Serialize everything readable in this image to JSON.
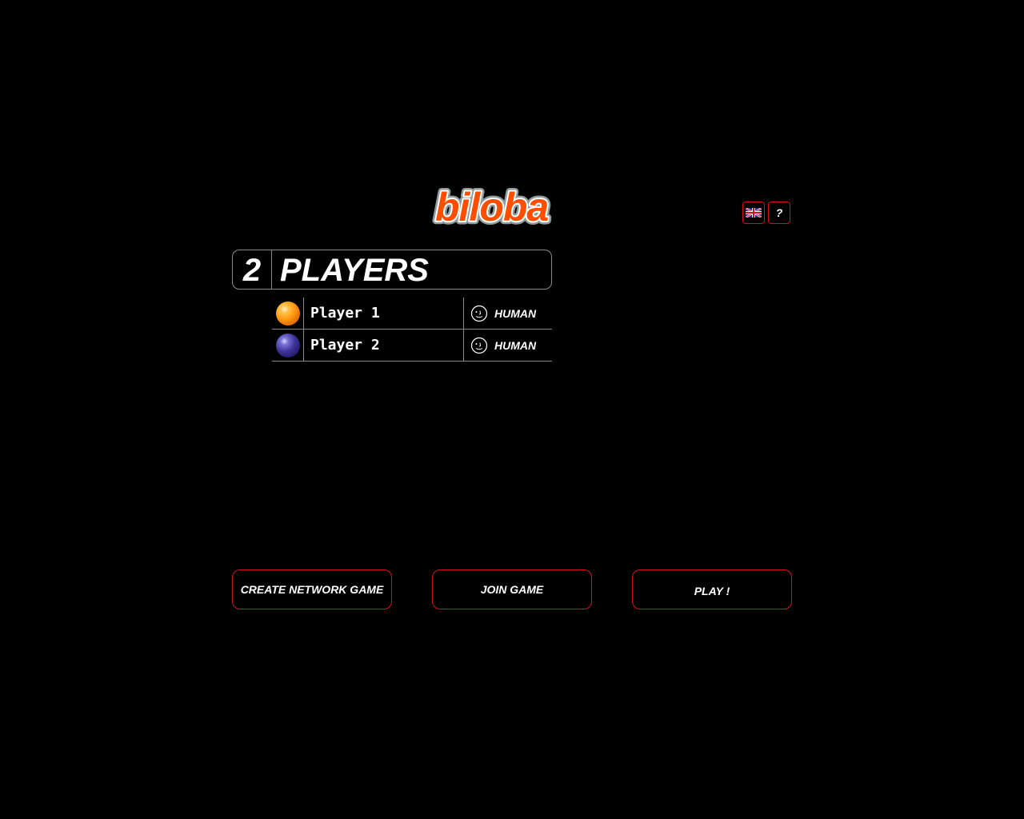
{
  "app": {
    "logo_text": "biloba"
  },
  "top_buttons": {
    "language_icon": "uk-flag-icon",
    "help_label": "?"
  },
  "players_panel": {
    "count": "2",
    "title": "PLAYERS"
  },
  "players": [
    {
      "name": "Player 1",
      "ball_color": "orange",
      "type_label": "HUMAN",
      "type_icon": "human-face-icon"
    },
    {
      "name": "Player 2",
      "ball_color": "blue",
      "type_label": "HUMAN",
      "type_icon": "human-face-icon"
    }
  ],
  "actions": {
    "create_network_game": "CREATE NETWORK GAME",
    "join_game": "JOIN GAME",
    "play": "PLAY !"
  },
  "colors": {
    "background": "#000000",
    "button_border": "#d4101a",
    "logo_orange": "#ff4e00",
    "table_border": "#8a8a8a"
  }
}
